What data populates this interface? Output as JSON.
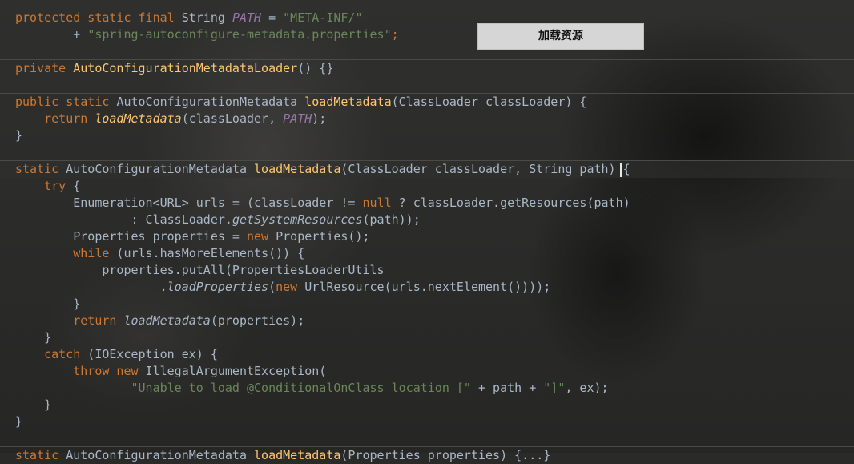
{
  "load_button": {
    "label": "加载资源"
  },
  "code": {
    "l01": {
      "kw1": "protected static final",
      "type": " String ",
      "cst": "PATH",
      "eq": " = ",
      "str": "\"META-INF/\""
    },
    "l02": {
      "plus": "        + ",
      "str": "\"spring-autoconfigure-metadata.properties\"",
      "end": ";"
    },
    "l03": {
      "kw": "private ",
      "fn": "AutoConfigurationMetadataLoader",
      "rest": "() {}"
    },
    "l04": {
      "kw": "public static ",
      "type": "AutoConfigurationMetadata ",
      "fn": "loadMetadata",
      "rest": "(ClassLoader classLoader) {"
    },
    "l05": {
      "kw": "    return ",
      "fn": "loadMetadata",
      "a": "(classLoader, ",
      "cst": "PATH",
      "b": ");"
    },
    "l06": {
      "text": "}"
    },
    "l07": {
      "kw": "static ",
      "type": "AutoConfigurationMetadata ",
      "fn": "loadMetadata",
      "rest": "(ClassLoader classLoader, String path) {"
    },
    "l08": {
      "kw": "    try",
      "rest": " {"
    },
    "l09": {
      "a": "        Enumeration<URL> urls = (classLoader != ",
      "kw": "null",
      "b": " ? classLoader.getResources(path)"
    },
    "l10": {
      "a": "                : ClassLoader.",
      "fn": "getSystemResources",
      "b": "(path));"
    },
    "l11": {
      "a": "        Properties properties = ",
      "kw": "new",
      "b": " Properties();"
    },
    "l12": {
      "kw": "        while",
      "rest": " (urls.hasMoreElements()) {"
    },
    "l13": {
      "text": "            properties.putAll(PropertiesLoaderUtils"
    },
    "l14": {
      "a": "                    .",
      "fn": "loadProperties",
      "b": "(",
      "kw": "new",
      "c": " UrlResource(urls.nextElement())));"
    },
    "l15": {
      "text": "        }"
    },
    "l16": {
      "kw": "        return ",
      "fn": "loadMetadata",
      "rest": "(properties);"
    },
    "l17": {
      "text": "    }"
    },
    "l18": {
      "kw": "    catch",
      "rest": " (IOException ex) {"
    },
    "l19": {
      "kw": "        throw new",
      "rest": " IllegalArgumentException("
    },
    "l20": {
      "a": "                ",
      "s1": "\"Unable to load @ConditionalOnClass location [\"",
      "b": " + path + ",
      "s2": "\"]\"",
      "c": ", ex);"
    },
    "l21": {
      "text": "    }"
    },
    "l22": {
      "text": "}"
    },
    "l23": {
      "kw": "static ",
      "type": "AutoConfigurationMetadata ",
      "fn": "loadMetadata",
      "rest": "(Properties properties) {...}"
    }
  }
}
